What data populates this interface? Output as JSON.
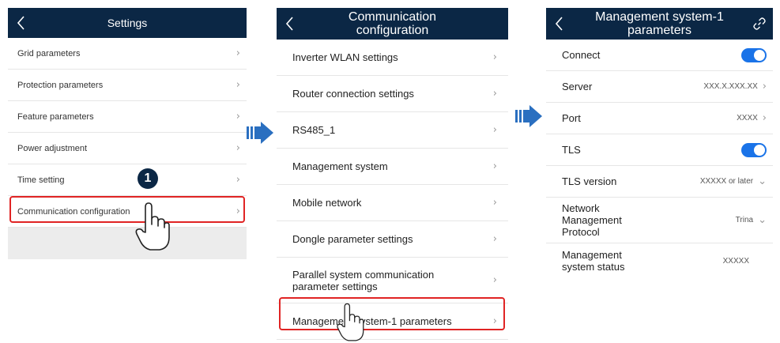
{
  "screen1": {
    "title": "Settings",
    "items": [
      {
        "label": "Grid parameters"
      },
      {
        "label": "Protection parameters"
      },
      {
        "label": "Feature parameters"
      },
      {
        "label": "Power adjustment"
      },
      {
        "label": "Time setting"
      },
      {
        "label": "Communication configuration"
      }
    ],
    "step_badge": "1"
  },
  "screen2": {
    "title_line1": "Communication",
    "title_line2": "configuration",
    "items": [
      {
        "label": "Inverter WLAN settings"
      },
      {
        "label": "Router connection settings"
      },
      {
        "label": "RS485_1"
      },
      {
        "label": "Management system"
      },
      {
        "label": "Mobile network"
      },
      {
        "label": "Dongle parameter settings"
      },
      {
        "label_line1": "Parallel system communication",
        "label_line2": "parameter settings"
      },
      {
        "label": "Management system-1 parameters"
      }
    ]
  },
  "screen3": {
    "title_line1": "Management system-1",
    "title_line2": "parameters",
    "rows": {
      "connect": {
        "label": "Connect"
      },
      "server": {
        "label": "Server",
        "value": "XXX.X.XXX.XX"
      },
      "port": {
        "label": "Port",
        "value": "XXXX"
      },
      "tls": {
        "label": "TLS"
      },
      "tls_version": {
        "label": "TLS version",
        "value": "XXXXX or later"
      },
      "nmp": {
        "label_line1": "Network",
        "label_line2": "Management",
        "label_line3": "Protocol",
        "value": "Trina"
      },
      "status": {
        "label_line1": "Management",
        "label_line2": "system status",
        "value": "XXXXX"
      }
    }
  },
  "colors": {
    "header": "#0b2745",
    "highlight": "#e02424",
    "toggle_on": "#1a73e8",
    "arrow": "#2a6fc0"
  }
}
